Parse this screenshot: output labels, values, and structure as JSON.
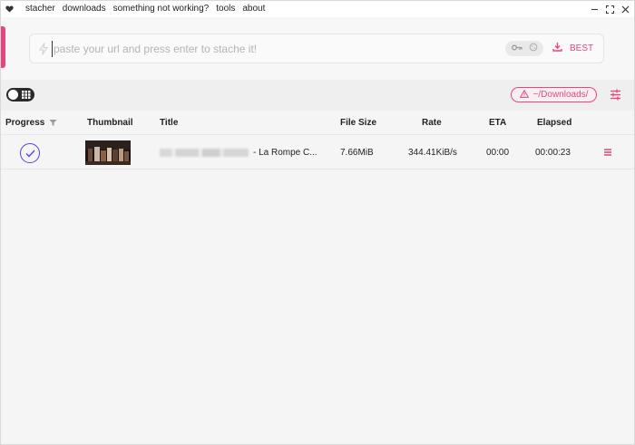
{
  "colors": {
    "accent": "#e8457a",
    "check": "#5b3fd6"
  },
  "menubar": {
    "logo_icon": "heart-icon",
    "items": [
      "stacher",
      "downloads",
      "something not working?",
      "tools",
      "about"
    ],
    "controls": [
      "minimize-icon",
      "maximize-icon",
      "close-icon"
    ]
  },
  "url": {
    "placeholder": "paste your url and press enter to stache it!",
    "value": "",
    "format_label": "BEST"
  },
  "toolbar": {
    "download_path": "~/Downloads/"
  },
  "table": {
    "headers": {
      "progress": "Progress",
      "thumbnail": "Thumbnail",
      "title": "Title",
      "file_size": "File Size",
      "rate": "Rate",
      "eta": "ETA",
      "elapsed": "Elapsed"
    },
    "rows": [
      {
        "status": "complete",
        "title": "- La Rompe C...",
        "file_size": "7.66MiB",
        "rate": "344.41KiB/s",
        "eta": "00:00",
        "elapsed": "00:00:23"
      }
    ]
  }
}
